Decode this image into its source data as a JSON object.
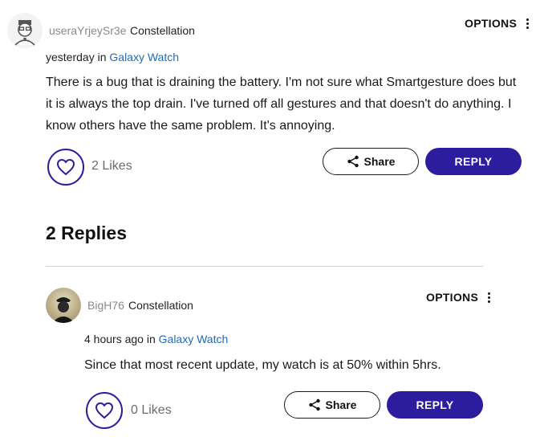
{
  "post": {
    "username": "useraYrjeySr3e",
    "rank": "Constellation",
    "time": "yesterday",
    "in_word": "in",
    "location": "Galaxy Watch",
    "body_lines": [
      "There is a bug that is draining the battery. I'm not sure what Smartgesture does but",
      "it is always the top drain. I've turned off all gestures and that doesn't do anything. I",
      "know others have the same problem. It's annoying."
    ],
    "likes": "2 Likes",
    "options_label": "OPTIONS",
    "share_label": "Share",
    "reply_label": "REPLY"
  },
  "replies_heading": "2 Replies",
  "reply": {
    "username": "BigH76",
    "rank": "Constellation",
    "time": "4 hours ago",
    "in_word": "in",
    "location": "Galaxy Watch",
    "body": "Since that most recent update, my watch is at 50% within 5hrs.",
    "likes": "0 Likes",
    "options_label": "OPTIONS",
    "share_label": "Share",
    "reply_label": "REPLY"
  },
  "icons": {
    "like": "heart-icon",
    "share": "share-icon",
    "options": "vertical-dots-icon"
  },
  "colors": {
    "accent": "#2b1d9e",
    "link": "#1f6bb8",
    "muted": "#8a8a8a"
  }
}
